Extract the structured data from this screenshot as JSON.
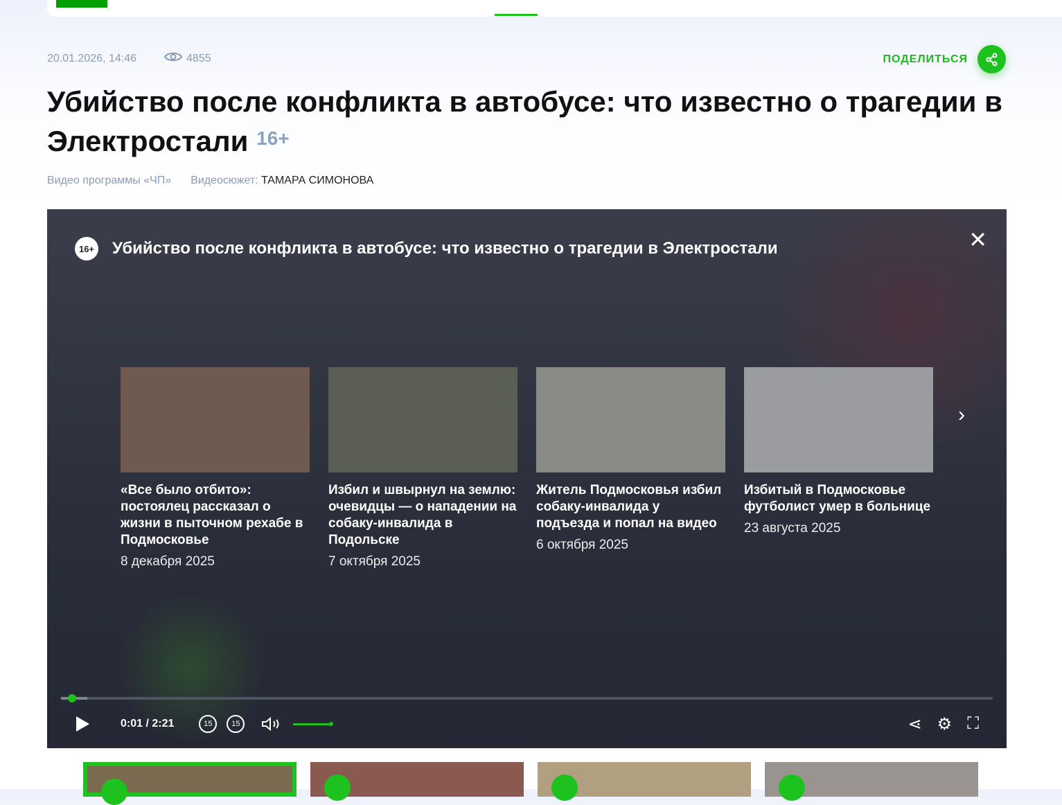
{
  "meta": {
    "date": "20.01.2026, 14:46",
    "views": "4855",
    "share_label": "ПОДЕЛИТЬСЯ"
  },
  "article": {
    "title": "Убийство после конфликта в автобусе: что известно о трагедии в Электростали",
    "age": "16+",
    "program": "Видео программы «ЧП»",
    "story_label": "Видеосюжет:",
    "story_name": "ТАМАРА СИМОНОВА"
  },
  "player": {
    "title": "Убийство после конфликта в автобусе: что известно о трагедии в Электростали",
    "age": "16+",
    "time": "0:01 / 2:21",
    "progress_percent": 0.7,
    "volume_percent": 100,
    "skip_back": "15",
    "skip_fwd": "15",
    "related": [
      {
        "title": "«Все было отбито»: постоялец рассказал о жизни в пыточном рехабе в Подмосковье",
        "date": "8 декабря 2025",
        "color": "#6f5a52"
      },
      {
        "title": "Избил и швырнул на землю: очевидцы — о нападении на собаку-инвалида в Подольске",
        "date": "7 октября 2025",
        "color": "#5a5e55"
      },
      {
        "title": "Житель Подмосковья избил собаку-инвалида у подъезда и попал на видео",
        "date": "6 октября 2025",
        "color": "#8a8a86"
      },
      {
        "title": "Избитый в Подмосковье футболист умер в больнице",
        "date": "23 августа 2025",
        "color": "#9a9ca0"
      }
    ]
  },
  "strip_colors": [
    "#7a6a50",
    "#8a5a50",
    "#b0a080",
    "#9a9490"
  ]
}
